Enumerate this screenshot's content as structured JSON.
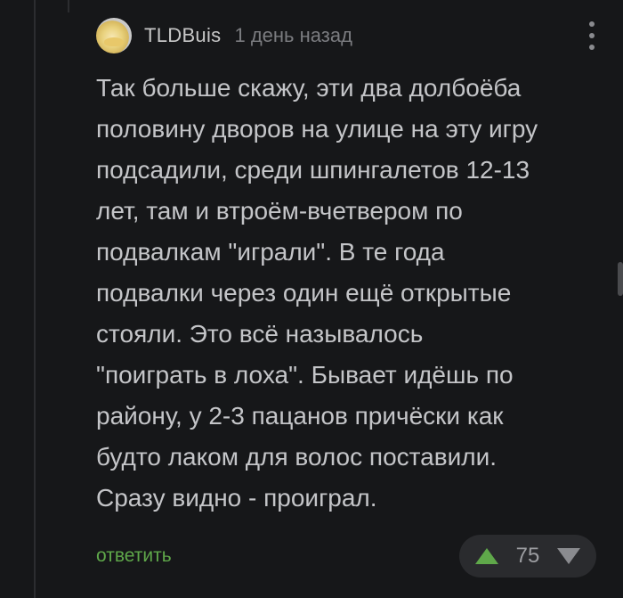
{
  "comment": {
    "author": "TLDBuis",
    "timestamp": "1 день назад",
    "avatar_icon": "avatar-icon",
    "more_icon": "more-vertical-icon",
    "lines": [
      "Так больше скажу, эти два долбоёба",
      "половину дворов на улице на эту игру",
      "подсадили, среди шпингалетов 12-13",
      "лет, там и втроём-вчетвером по",
      "подвалкам \"играли\". В те года",
      "подвалки через один ещё открытые",
      "стояли. Это всё называлось",
      "\"поиграть в лоха\". Бывает идёшь по",
      "району, у 2-3 пацанов причёски как",
      "будто лаком для волос поставили.",
      "Сразу видно - проиграл."
    ]
  },
  "footer": {
    "reply_label": "ответить",
    "rating": "75",
    "upvote_icon": "upvote-arrow-icon",
    "downvote_icon": "downvote-arrow-icon"
  },
  "colors": {
    "background": "#161719",
    "accent_green": "#5fa84a",
    "text": "#c4c5c8",
    "muted": "#7b7c80"
  }
}
